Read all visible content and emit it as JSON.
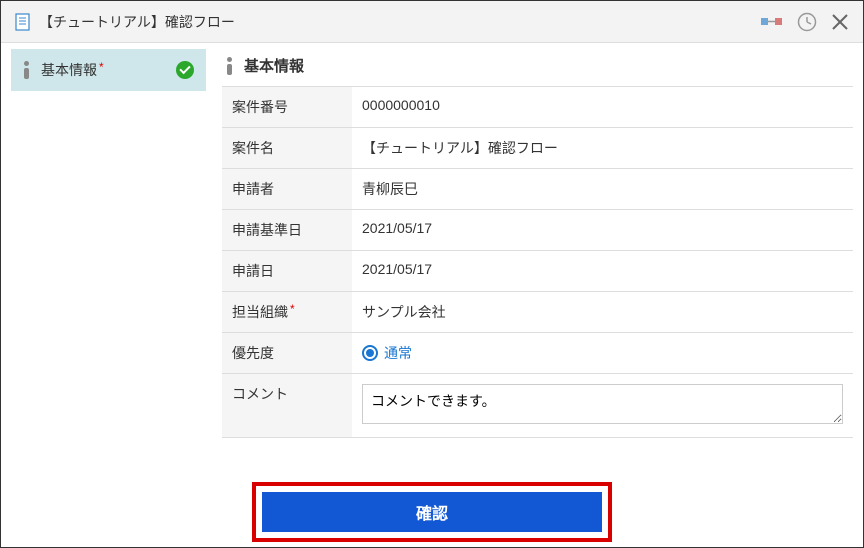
{
  "header": {
    "title": "【チュートリアル】確認フロー"
  },
  "sidebar": {
    "items": [
      {
        "label": "基本情報",
        "required": true,
        "completed": true
      }
    ]
  },
  "main": {
    "section_title": "基本情報",
    "fields": {
      "case_number": {
        "label": "案件番号",
        "value": "0000000010"
      },
      "case_name": {
        "label": "案件名",
        "value": "【チュートリアル】確認フロー"
      },
      "applicant": {
        "label": "申請者",
        "value": "青柳辰巳"
      },
      "base_date": {
        "label": "申請基準日",
        "value": "2021/05/17"
      },
      "apply_date": {
        "label": "申請日",
        "value": "2021/05/17"
      },
      "org": {
        "label": "担当組織",
        "required": true,
        "value": "サンプル会社"
      },
      "priority": {
        "label": "優先度",
        "value": "通常"
      },
      "comment": {
        "label": "コメント",
        "value": "コメントできます。"
      }
    }
  },
  "footer": {
    "confirm_label": "確認"
  },
  "required_mark": "*"
}
